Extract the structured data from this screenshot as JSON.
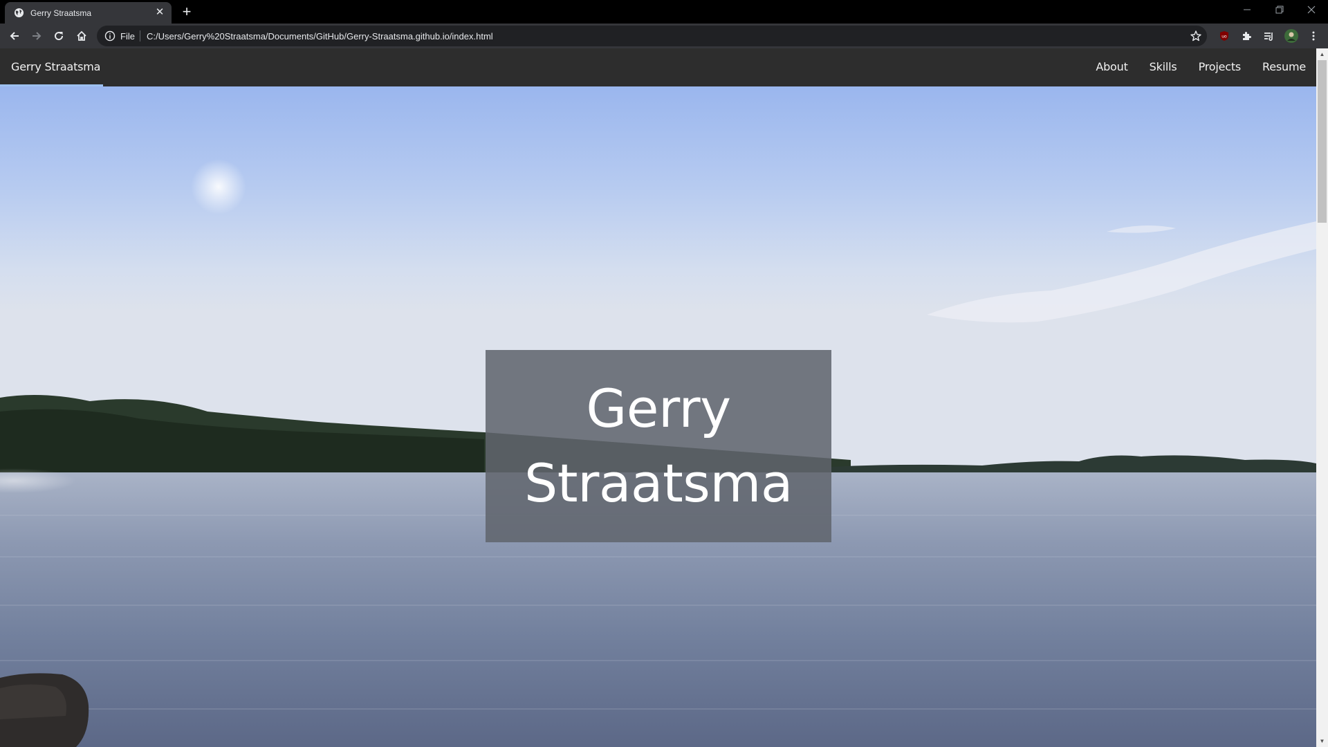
{
  "browser": {
    "tab_title": "Gerry Straatsma",
    "scheme_label": "File",
    "url": "C:/Users/Gerry%20Straatsma/Documents/GitHub/Gerry-Straatsma.github.io/index.html",
    "new_tab_glyph": "+",
    "close_glyph": "✕",
    "icons": [
      "globe-icon",
      "close-icon",
      "plus-icon",
      "back-icon",
      "forward-icon",
      "reload-icon",
      "home-icon",
      "info-icon",
      "star-icon",
      "ublock-icon",
      "extensions-icon",
      "reading-list-icon",
      "profile-avatar",
      "menu-icon",
      "minimize-icon",
      "restore-icon",
      "window-close-icon"
    ]
  },
  "site": {
    "brand": "Gerry Straatsma",
    "nav": [
      "About",
      "Skills",
      "Projects",
      "Resume"
    ],
    "hero_title_line1": "Gerry",
    "hero_title_line2": "Straatsma"
  },
  "colors": {
    "navbar": "#2d2d2d",
    "brand_underline": "#9ec2f0",
    "title_box": "#60646c"
  }
}
